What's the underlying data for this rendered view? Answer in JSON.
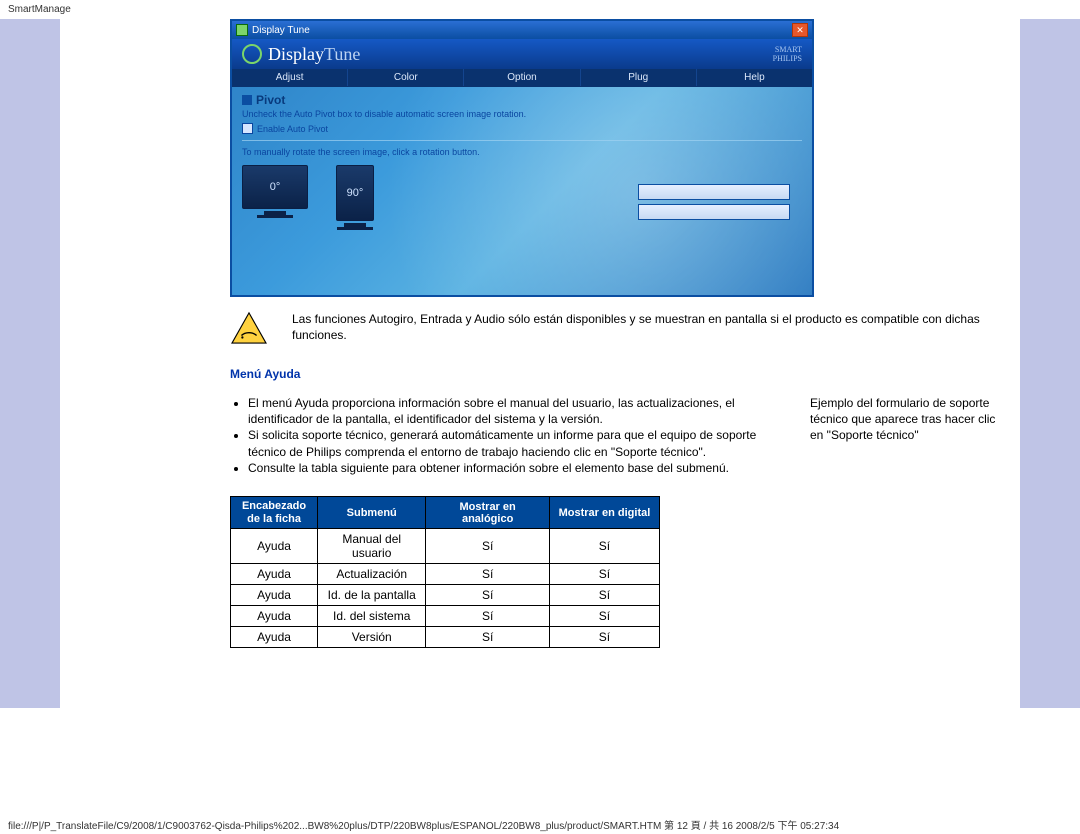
{
  "page": {
    "header": "SmartManage",
    "footer": "file:///P|/P_TranslateFile/C9/2008/1/C9003762-Qisda-Philips%202...BW8%20plus/DTP/220BW8plus/ESPANOL/220BW8_plus/product/SMART.HTM 第 12 頁 / 共 16 2008/2/5 下午 05:27:34"
  },
  "app": {
    "titlebar": "Display Tune",
    "brand_main": "Display",
    "brand_accent": " Tune",
    "brand_tag1": "SMART",
    "brand_tag2": "PHILIPS",
    "tabs": [
      "Adjust",
      "Color",
      "Option",
      "Plug",
      "Help"
    ],
    "pivot_title": "Pivot",
    "pivot_info": "Uncheck the Auto Pivot box to disable automatic screen image rotation.",
    "pivot_checkbox": "Enable Auto Pivot",
    "pivot_manual": "To manually rotate the screen image, click a rotation button.",
    "rot_0": "0°",
    "rot_90": "90°"
  },
  "warning": "Las funciones Autogiro, Entrada y Audio sólo están disponibles y se muestran en pantalla si el producto es compatible con dichas funciones.",
  "help_section": {
    "heading": "Menú Ayuda",
    "bullets": [
      "El menú Ayuda proporciona información sobre el manual del usuario, las actualizaciones, el identificador de la pantalla, el identificador del sistema y la versión.",
      "Si solicita soporte técnico, generará automáticamente un informe para que el equipo de soporte técnico de Philips comprenda el entorno de trabajo haciendo clic en \"Soporte técnico\".",
      "Consulte la tabla siguiente para obtener información sobre el elemento base del submenú."
    ],
    "right_note": "Ejemplo del formulario de soporte técnico que aparece tras hacer clic en \"Soporte técnico\""
  },
  "table": {
    "headers": [
      "Encabezado de la ficha",
      "Submenú",
      "Mostrar en analógico",
      "Mostrar en digital"
    ],
    "rows": [
      [
        "Ayuda",
        "Manual del usuario",
        "Sí",
        "Sí"
      ],
      [
        "Ayuda",
        "Actualización",
        "Sí",
        "Sí"
      ],
      [
        "Ayuda",
        "Id. de la pantalla",
        "Sí",
        "Sí"
      ],
      [
        "Ayuda",
        "Id. del sistema",
        "Sí",
        "Sí"
      ],
      [
        "Ayuda",
        "Versión",
        "Sí",
        "Sí"
      ]
    ]
  }
}
